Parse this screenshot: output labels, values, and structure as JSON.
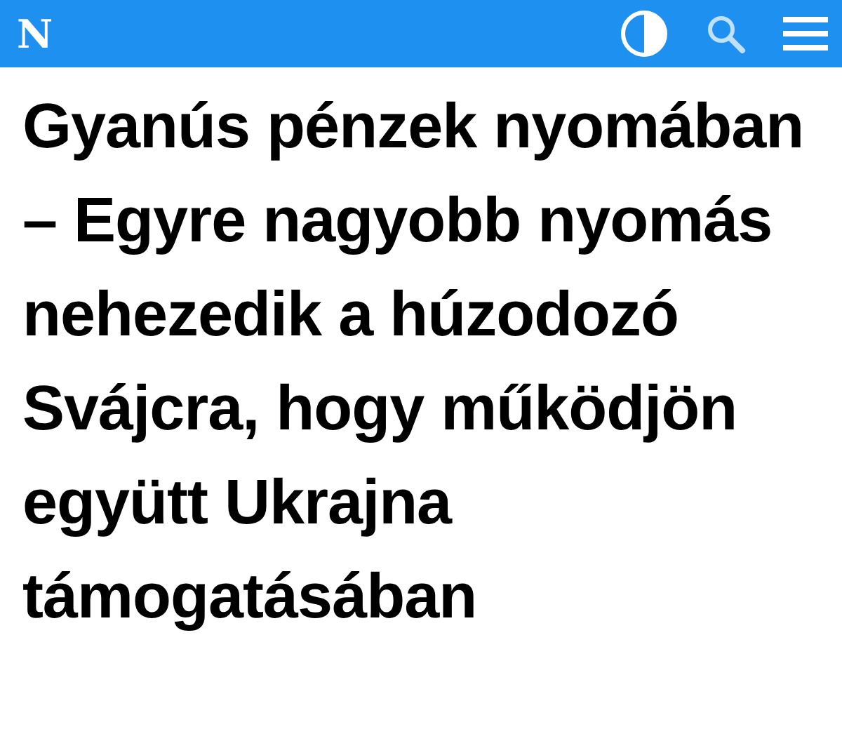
{
  "header": {
    "logo": "N"
  },
  "headline": "Gyanús pénzek nyomában – Egyre nagyobb nyomás nehezedik a húzodozó Svájcra, hogy működjön együtt Ukrajna támogatásában"
}
